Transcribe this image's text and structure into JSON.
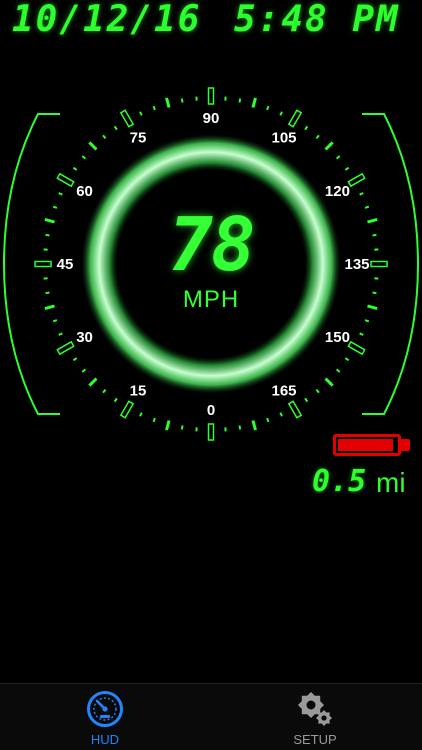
{
  "header": {
    "date": "10/12/16",
    "time": "5:48 PM"
  },
  "gauge": {
    "min": 0,
    "max": 180,
    "scale_labels": [
      "0",
      "15",
      "30",
      "45",
      "60",
      "75",
      "90",
      "105",
      "120",
      "135",
      "150",
      "165"
    ],
    "needle_value": 78,
    "current_speed": "78",
    "speed_unit": "MPH"
  },
  "status": {
    "battery_level": 0.95,
    "battery_color": "#e20000",
    "distance_value": "0.5",
    "distance_unit": "mi"
  },
  "tab_bar": {
    "tabs": [
      {
        "label": "HUD",
        "icon": "speedometer-icon",
        "active": true
      },
      {
        "label": "SETUP",
        "icon": "gears-icon",
        "active": false
      }
    ]
  },
  "colors": {
    "accent_green": "#2cff2c",
    "needle": "#ff3b00",
    "active_tab": "#1f86ff",
    "inactive_tab": "#9a9a9a",
    "background": "#000000"
  }
}
